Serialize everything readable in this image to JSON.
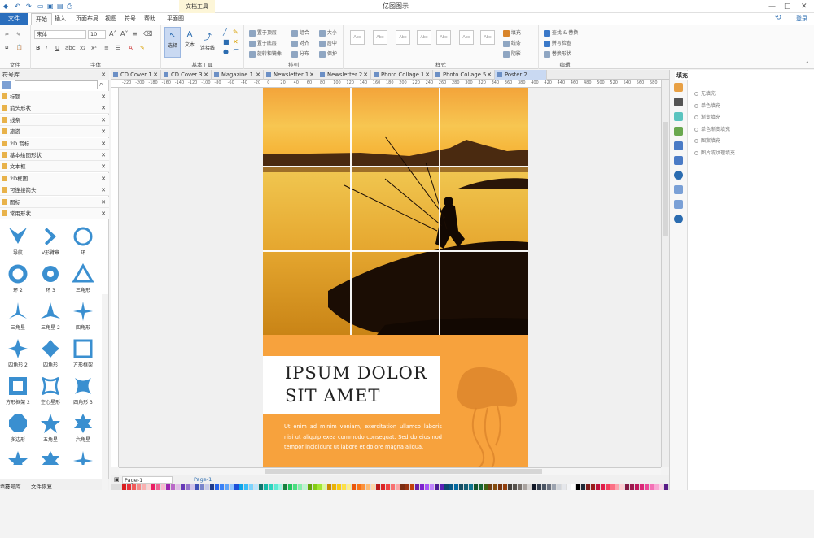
{
  "app": {
    "title": "亿图图示",
    "context_tab": "文档工具",
    "window_controls": [
      "—",
      "□",
      "✕"
    ]
  },
  "menu": {
    "file": "文件",
    "items": [
      "开始",
      "插入",
      "页面布局",
      "视图",
      "符号",
      "帮助",
      "平面图"
    ],
    "login": "登录"
  },
  "ribbon": {
    "groups": {
      "file": "文件",
      "font": "字体",
      "basic_tools": "基本工具",
      "arrange": "排列",
      "style": "样式",
      "edit": "编辑"
    },
    "font_name": "宋体",
    "font_size": "10",
    "tools": [
      "选择",
      "文本",
      "连接线"
    ],
    "arrange_items": [
      "置于顶层",
      "组合",
      "大小",
      "置于底层",
      "对齐",
      "居中",
      "旋转和镜像",
      "分布",
      "保护"
    ],
    "style_items": [
      "填充",
      "线条",
      "阴影"
    ],
    "edit_items": [
      "查找 & 替换",
      "拼写检查",
      "替换形状"
    ]
  },
  "library": {
    "title": "符号库",
    "categories": [
      "标题",
      "箭头形状",
      "线条",
      "旅游",
      "2D 箭标",
      "基本绘图形状",
      "文本框",
      "2D框图",
      "可连接箭头",
      "图标",
      "常用形状"
    ],
    "shapes": [
      {
        "label": "导航",
        "icon": "chevron-down-icon"
      },
      {
        "label": "V形臂章",
        "icon": "chevron-right-icon"
      },
      {
        "label": "环",
        "icon": "ring-icon"
      },
      {
        "label": "环 2",
        "icon": "ring-thick-icon"
      },
      {
        "label": "环 3",
        "icon": "ring-dot-icon"
      },
      {
        "label": "三角形",
        "icon": "triangle-icon"
      },
      {
        "label": "三角星",
        "icon": "three-star-icon"
      },
      {
        "label": "三角星 2",
        "icon": "three-star2-icon"
      },
      {
        "label": "四角形",
        "icon": "four-star-icon"
      },
      {
        "label": "四角形 2",
        "icon": "four-star2-icon"
      },
      {
        "label": "四角形",
        "icon": "four-star3-icon"
      },
      {
        "label": "方形框架",
        "icon": "square-frame-icon"
      },
      {
        "label": "方形框架 2",
        "icon": "square-frame2-icon"
      },
      {
        "label": "空心星形",
        "icon": "hollow-star-icon"
      },
      {
        "label": "四角形 3",
        "icon": "four-star4-icon"
      },
      {
        "label": "多边形",
        "icon": "polygon-icon"
      },
      {
        "label": "五角星",
        "icon": "five-star-icon"
      },
      {
        "label": "六角星",
        "icon": "six-star-icon"
      }
    ],
    "bottom_tabs": [
      "符号库",
      "文件恢复"
    ]
  },
  "tabs": [
    "CD Cover 1",
    "CD Cover 3",
    "Magazine 1",
    "Newsletter 1",
    "Newsletter 2",
    "Photo Collage 1",
    "Photo Collage 5",
    "Poster 2"
  ],
  "ruler_ticks": [
    "-220",
    "-200",
    "-180",
    "-160",
    "-140",
    "-120",
    "-100",
    "-80",
    "-60",
    "-40",
    "-20",
    "0",
    "20",
    "40",
    "60",
    "80",
    "100",
    "120",
    "140",
    "160",
    "180",
    "200",
    "220",
    "240",
    "260",
    "280",
    "300",
    "320",
    "340",
    "360",
    "380",
    "400",
    "420",
    "440",
    "460",
    "480",
    "500",
    "520",
    "540",
    "560",
    "580"
  ],
  "poster": {
    "title_line1": "IPSUM DOLOR",
    "title_line2": "SIT AMET",
    "body": "Ut enim ad minim veniam, exercitation ullamco laboris nisi ut aliquip exea commodo consequat. Sed do eiusmod tempor incididunt ut labore et dolore magna aliqua.",
    "bg_color": "#f7a23d"
  },
  "pagebar": {
    "page_select": "Page-1",
    "page_tab": "Page-1"
  },
  "fill_panel": {
    "title": "填充",
    "options": [
      "无填充",
      "单色填充",
      "渐变填充",
      "单色渐变填充",
      "图案填充",
      "图片或纹理填充"
    ]
  },
  "palette_label": "填充"
}
